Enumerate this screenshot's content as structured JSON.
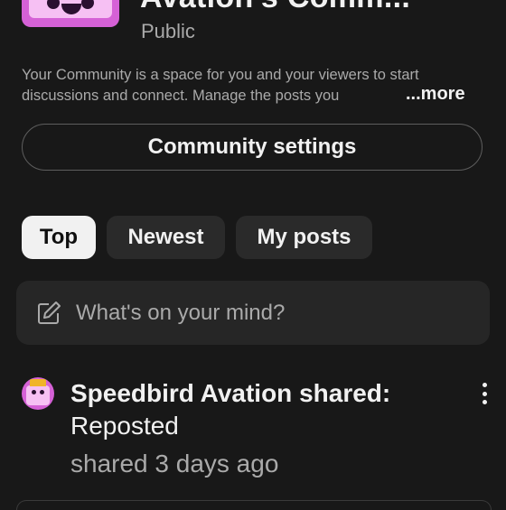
{
  "header": {
    "channel_title": "Avation's Comm...",
    "visibility": "Public"
  },
  "description": {
    "line1": "Your Community is a space for you and your viewers to start",
    "line2": "discussions and connect. Manage the posts you",
    "more_label": "...more"
  },
  "settings": {
    "label": "Community settings"
  },
  "filters": {
    "chips": [
      {
        "label": "Top",
        "selected": true
      },
      {
        "label": "Newest",
        "selected": false
      },
      {
        "label": "My posts",
        "selected": false
      }
    ]
  },
  "composer": {
    "placeholder": "What's on your mind?",
    "icon": "edit-icon"
  },
  "post": {
    "author_line": "Speedbird Avation shared:",
    "text": "Reposted",
    "time": "shared 3 days ago",
    "menu_icon": "more-vertical-icon"
  },
  "colors": {
    "background": "#181818",
    "surface": "#262626",
    "chip_inactive": "#2a2a2a",
    "chip_active": "#f1f1f1",
    "text_primary": "#f1f1f1",
    "text_secondary": "#aaaaaa",
    "avatar_accent": "#d561d6"
  }
}
